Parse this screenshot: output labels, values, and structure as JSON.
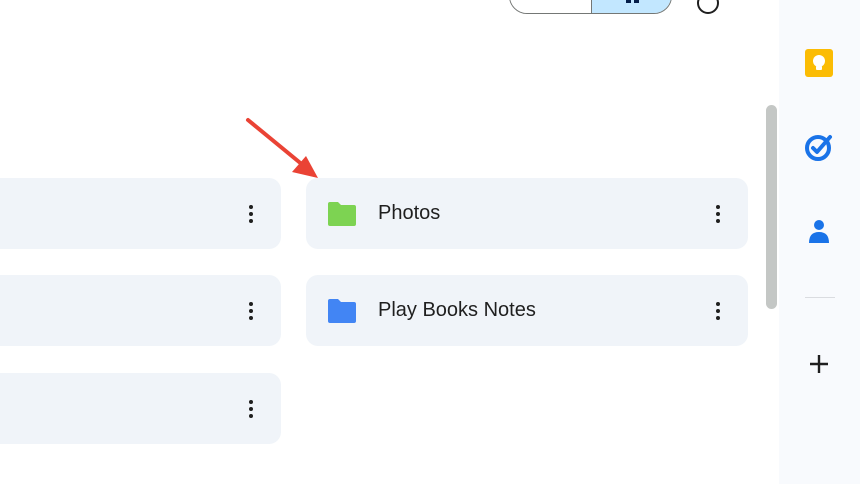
{
  "folders": [
    {
      "name": "",
      "icon": "folder-icon",
      "color": "#f0f4f9"
    },
    {
      "name": "",
      "icon": "folder-icon",
      "color": "#f0f4f9"
    },
    {
      "name": "",
      "icon": "folder-icon",
      "color": "#f0f4f9"
    },
    {
      "name": "Photos",
      "icon": "folder-icon",
      "color": "#7dd352"
    },
    {
      "name": "Play Books Notes",
      "icon": "folder-icon",
      "color": "#4285f4"
    }
  ],
  "side_panel": {
    "apps": [
      "keep-icon",
      "tasks-icon",
      "contacts-icon"
    ],
    "add_icon": "plus-icon"
  },
  "colors": {
    "card_bg": "#f0f4f9",
    "photos_folder": "#7dd352",
    "books_folder": "#4285f4",
    "keep": "#fbbc04",
    "tasks": "#1a73e8",
    "contacts": "#1a73e8",
    "annotation_arrow": "#ea4335"
  }
}
